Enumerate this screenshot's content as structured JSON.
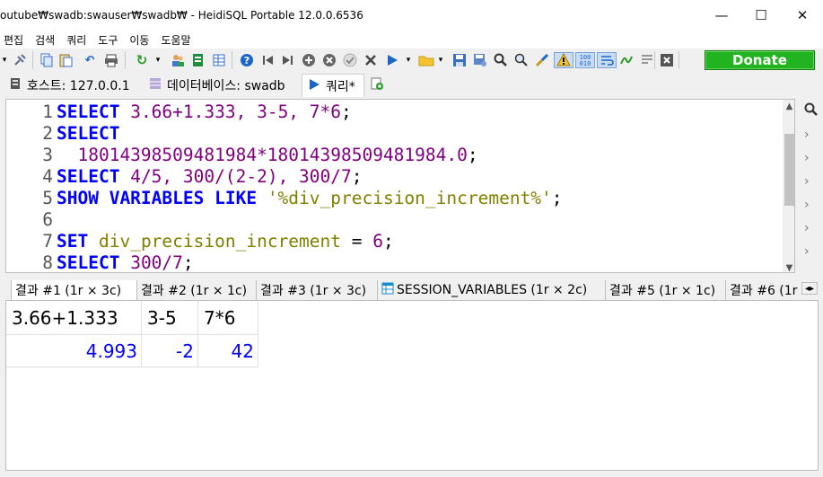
{
  "window": {
    "title": "outube₩swadb:swauser₩swadb₩ - HeidiSQL Portable 12.0.0.6536",
    "minimize": "—",
    "maximize": "☐",
    "close": "✕"
  },
  "menu": [
    "편집",
    "검색",
    "쿼리",
    "도구",
    "이동",
    "도움말"
  ],
  "toolbar": {
    "icons": [
      "dropdown-arrow-icon",
      "connect-icon",
      "copy-icon",
      "paste-icon",
      "undo-icon",
      "print-icon",
      "refresh-icon",
      "dropdown-arrow-icon",
      "user-manager-icon",
      "export-icon",
      "table-tools-icon",
      "help-icon",
      "first-icon",
      "last-icon",
      "add-icon",
      "delete-icon",
      "check-icon",
      "cancel-icon",
      "run-icon",
      "run-dropdown-icon",
      "open-folder-icon",
      "open-dropdown-icon",
      "save-icon",
      "save-snippet-icon",
      "find-icon",
      "find-next-icon",
      "format-icon",
      "warning-icon",
      "binary-icon",
      "word-wrap-icon",
      "log-icon",
      "close-tab-icon"
    ],
    "donate_label": "Donate"
  },
  "tabs": [
    {
      "label": "호스트: 127.0.0.1",
      "icon": "host-icon"
    },
    {
      "label": "데이터베이스: swadb",
      "icon": "database-icon"
    },
    {
      "label": "쿼리*",
      "icon": "query-play-icon"
    },
    {
      "label": "",
      "icon": "new-query-tab-icon"
    }
  ],
  "editor": {
    "line_numbers": [
      "1",
      "2",
      "3",
      "4",
      "5",
      "6",
      "7",
      "8"
    ],
    "lines": [
      [
        {
          "t": "SELECT",
          "c": "kw"
        },
        {
          "t": " ",
          "c": ""
        },
        {
          "t": "3.66+1.333, 3-5, 7*6",
          "c": "num"
        },
        {
          "t": ";",
          "c": ""
        }
      ],
      [
        {
          "t": "SELECT",
          "c": "kw"
        }
      ],
      [
        {
          "t": "  ",
          "c": ""
        },
        {
          "t": "18014398509481984*18014398509481984.0",
          "c": "num"
        },
        {
          "t": ";",
          "c": ""
        }
      ],
      [
        {
          "t": "SELECT",
          "c": "kw"
        },
        {
          "t": " ",
          "c": ""
        },
        {
          "t": "4/5, 300/(2-2), 300/7",
          "c": "num"
        },
        {
          "t": ";",
          "c": ""
        }
      ],
      [
        {
          "t": "SHOW VARIABLES LIKE",
          "c": "kw"
        },
        {
          "t": " ",
          "c": ""
        },
        {
          "t": "'%div_precision_increment%'",
          "c": "str"
        },
        {
          "t": ";",
          "c": ""
        }
      ],
      [],
      [
        {
          "t": "SET",
          "c": "kw"
        },
        {
          "t": " ",
          "c": ""
        },
        {
          "t": "div_precision_increment",
          "c": "var"
        },
        {
          "t": " = ",
          "c": ""
        },
        {
          "t": "6",
          "c": "num"
        },
        {
          "t": ";",
          "c": ""
        }
      ],
      [
        {
          "t": "SELECT",
          "c": "kw"
        },
        {
          "t": " ",
          "c": ""
        },
        {
          "t": "300/7",
          "c": "num"
        },
        {
          "t": ";",
          "c": ""
        }
      ]
    ]
  },
  "result_tabs": [
    "결과 #1 (1r × 3c)",
    "결과 #2 (1r × 1c)",
    "결과 #3 (1r × 3c)",
    "SESSION_VARIABLES (1r × 2c)",
    "결과 #5 (1r × 1c)",
    "결과 #6 (1r"
  ],
  "grid": {
    "headers": [
      "3.66+1.333",
      "3-5",
      "7*6"
    ],
    "rows": [
      [
        "4.993",
        "-2",
        "42"
      ]
    ]
  }
}
